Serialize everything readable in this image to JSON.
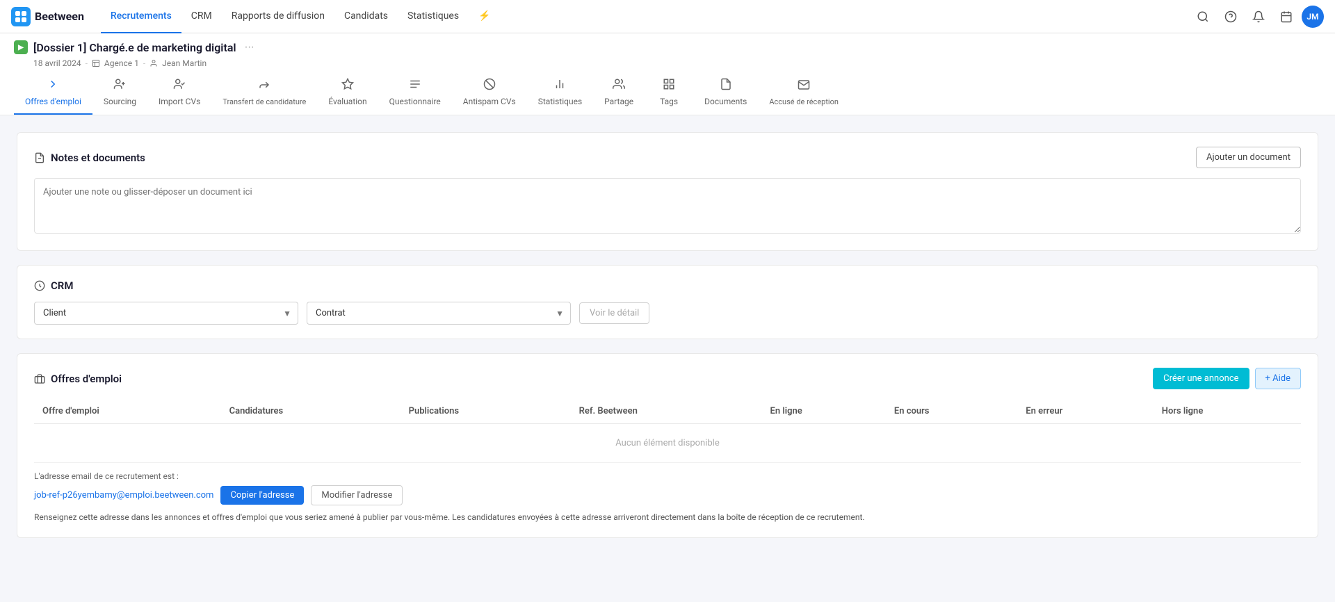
{
  "nav": {
    "logo_text": "Beetween",
    "items": [
      {
        "label": "Recrutements",
        "active": true
      },
      {
        "label": "CRM",
        "active": false
      },
      {
        "label": "Rapports de diffusion",
        "active": false
      },
      {
        "label": "Candidats",
        "active": false
      },
      {
        "label": "Statistiques",
        "active": false
      }
    ],
    "user_initials": "JM"
  },
  "dossier": {
    "title": "[Dossier 1] Chargé.e de marketing digital",
    "date": "18 avril 2024",
    "agency": "Agence 1",
    "user": "Jean Martin"
  },
  "tabs": [
    {
      "label": "Offres d'emploi",
      "active": true,
      "icon": "→"
    },
    {
      "label": "Sourcing",
      "active": false,
      "icon": "👤+"
    },
    {
      "label": "Import CVs",
      "active": false,
      "icon": "👤↑"
    },
    {
      "label": "Transfert de candidature",
      "active": false,
      "icon": "→👤"
    },
    {
      "label": "Évaluation",
      "active": false,
      "icon": "☆"
    },
    {
      "label": "Questionnaire",
      "active": false,
      "icon": "≡?"
    },
    {
      "label": "Antispam CVs",
      "active": false,
      "icon": "⊘"
    },
    {
      "label": "Statistiques",
      "active": false,
      "icon": "📊"
    },
    {
      "label": "Partage",
      "active": false,
      "icon": "👤👤"
    },
    {
      "label": "Tags",
      "active": false,
      "icon": "⊞"
    },
    {
      "label": "Documents",
      "active": false,
      "icon": "📄"
    },
    {
      "label": "Accusé de réception",
      "active": false,
      "icon": "✉"
    }
  ],
  "notes_section": {
    "title": "Notes et documents",
    "placeholder": "Ajouter une note ou glisser-déposer un document ici",
    "add_button": "Ajouter un document"
  },
  "crm_section": {
    "title": "CRM",
    "client_placeholder": "Client",
    "contrat_placeholder": "Contrat",
    "voir_detail": "Voir le détail",
    "client_options": [
      "Client"
    ],
    "contrat_options": [
      "Contrat"
    ]
  },
  "offres_section": {
    "title": "Offres d'emploi",
    "create_button": "Créer une annonce",
    "help_button": "+ Aide",
    "table_headers": [
      "Offre d'emploi",
      "Candidatures",
      "Publications",
      "Ref. Beetween",
      "En ligne",
      "En cours",
      "En erreur",
      "Hors ligne"
    ],
    "empty_message": "Aucun élément disponible",
    "email_label": "L'adresse email de ce recrutement est :",
    "email_address": "job-ref-p26yembamy@emploi.beetween.com",
    "copy_button": "Copier l'adresse",
    "modify_button": "Modifier l'adresse",
    "email_note": "Renseignez cette adresse dans les annonces et offres d'emploi que vous seriez amené à publier par vous-même. Les candidatures envoyées à cette adresse arriveront directement dans la boîte de réception de ce recrutement."
  }
}
